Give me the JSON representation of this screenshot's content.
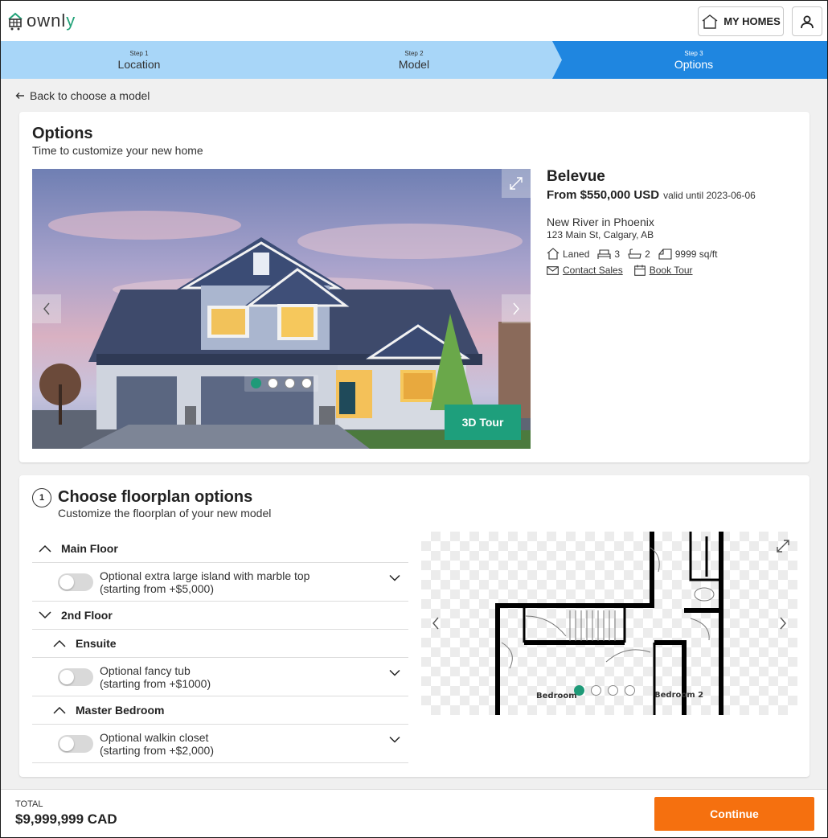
{
  "header": {
    "logo_text_a": "ownl",
    "logo_text_b": "y",
    "my_homes_label": "MY HOMES"
  },
  "steps": [
    {
      "small": "Step 1",
      "label": "Location",
      "active": false
    },
    {
      "small": "Step 2",
      "label": "Model",
      "active": false
    },
    {
      "small": "Step 3",
      "label": "Options",
      "active": true
    }
  ],
  "back_link": "Back to choose a model",
  "options_card": {
    "title": "Options",
    "subtitle": "Time to customize your new home",
    "hero_button": "3D Tour",
    "carousel_count": 4,
    "carousel_active": 0
  },
  "home": {
    "name": "Belevue",
    "price": "From $550,000 USD",
    "valid": "valid until 2023-06-06",
    "community": "New River in Phoenix",
    "address": "123 Main St, Calgary, AB",
    "type": "Laned",
    "beds": "3",
    "baths": "2",
    "area": "9999 sq/ft",
    "contact": "Contact Sales",
    "book": "Book Tour"
  },
  "floorplan": {
    "number": "1",
    "title": "Choose floorplan options",
    "subtitle": "Customize the floorplan of your new model",
    "sections": {
      "main_floor": "Main Floor",
      "second_floor": "2nd Floor",
      "ensuite": "Ensuite",
      "master": "Master Bedroom"
    },
    "options": {
      "island_a": "Optional extra large island with marble top",
      "island_b": "(starting from +$5,000)",
      "tub_a": "Optional fancy tub",
      "tub_b": "(starting from +$1000)",
      "closet_a": "Optional walkin closet",
      "closet_b": "(starting from +$2,000)"
    },
    "plan_labels": {
      "bedroom": "Bedroom",
      "bedroom2": "Bedroom 2"
    }
  },
  "footer": {
    "total_label": "TOTAL",
    "total_value": "$9,999,999 CAD",
    "continue_label": "Continue"
  },
  "colors": {
    "accent_green": "#1e9f7c",
    "step_blue": "#1f86e0",
    "step_light": "#a8d6f8",
    "continue_orange": "#f5700f"
  }
}
